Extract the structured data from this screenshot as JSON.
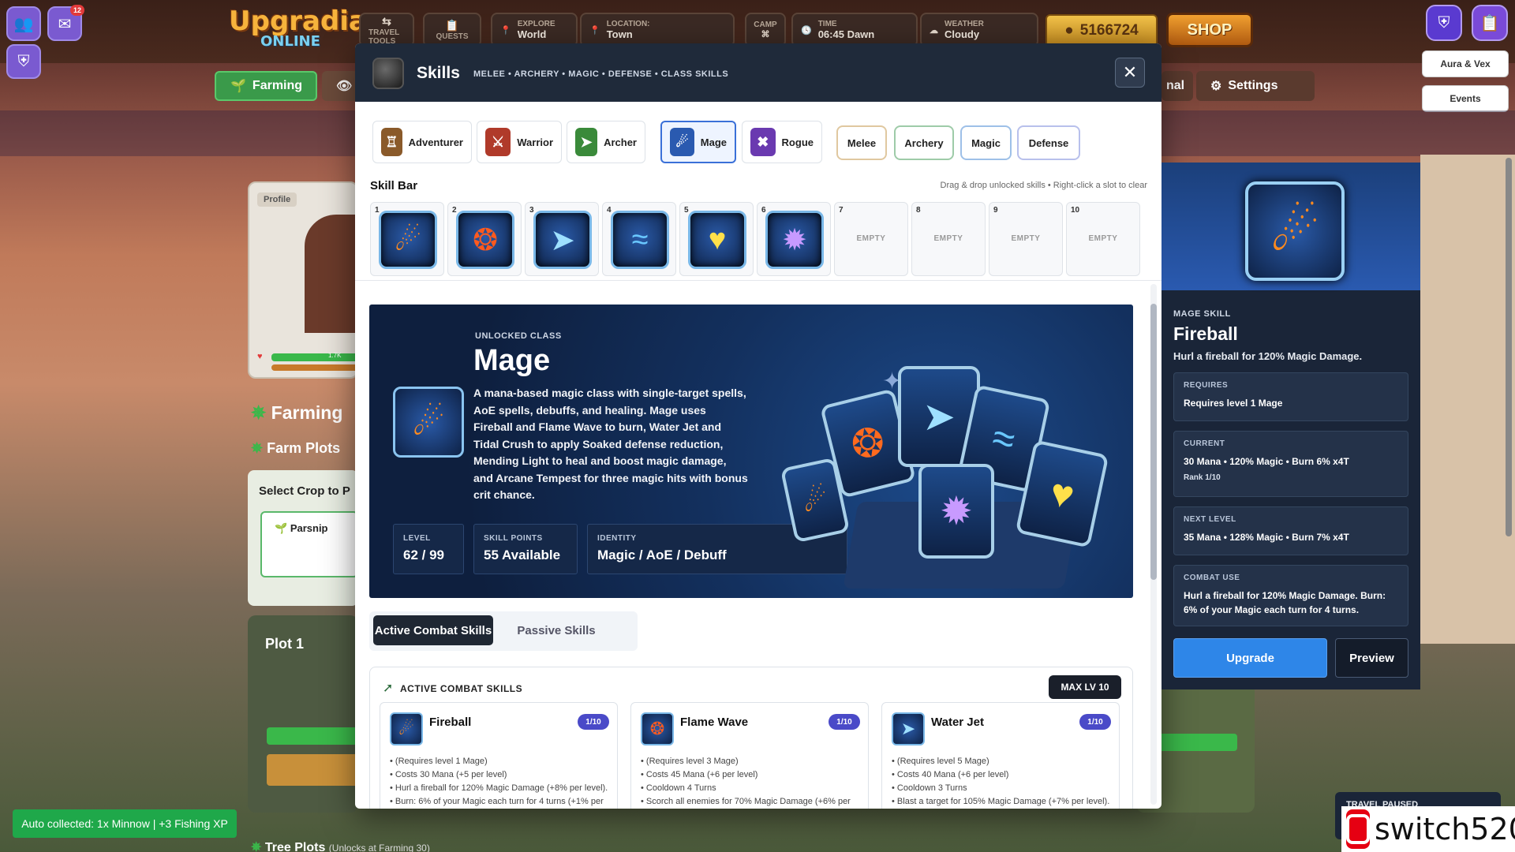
{
  "hud": {
    "logo_top": "Upgradia",
    "logo_bottom": "ONLINE",
    "travel_label": "TRAVEL TOOLS",
    "quests_label": "QUESTS",
    "explore_label": "EXPLORE",
    "explore_value": "World",
    "location_label": "LOCATION:",
    "location_value": "Town",
    "camp_label": "CAMP",
    "time_label": "TIME",
    "time_value": "06:45 Dawn",
    "weather_label": "WEATHER",
    "weather_value": "Cloudy",
    "coins": "5166724",
    "shop": "SHOP",
    "mail_badge": "12"
  },
  "nav": {
    "farming": "Farming",
    "settings": "Settings",
    "hidden_tab_fragment": "nal"
  },
  "side_buttons": {
    "aura": "Aura & Vex",
    "events": "Events"
  },
  "background": {
    "profile_label": "Profile",
    "farming_title": "Farming",
    "farm_plots": "Farm Plots",
    "select_crop": "Select Crop to P",
    "parsnip": "Parsnip",
    "plot1": "Plot 1",
    "tree_plots": "Tree Plots",
    "tree_unlock": "(Unlocks at Farming 30)",
    "hp_value": "1.7K"
  },
  "modal": {
    "title": "Skills",
    "subtitle": "MELEE • ARCHERY • MAGIC • DEFENSE • CLASS SKILLS",
    "class_tabs": [
      {
        "label": "Adventurer",
        "icon": "adventurer-icon",
        "color": "#8a5a2a"
      },
      {
        "label": "Warrior",
        "icon": "warrior-icon",
        "color": "#b03a2a"
      },
      {
        "label": "Archer",
        "icon": "archer-icon",
        "color": "#3a8a3a"
      },
      {
        "label": "Mage",
        "icon": "mage-icon",
        "color": "#2a5ab0"
      },
      {
        "label": "Rogue",
        "icon": "rogue-icon",
        "color": "#6a3ab0"
      }
    ],
    "active_class": "Mage",
    "filters": [
      "Melee",
      "Archery",
      "Magic",
      "Defense"
    ],
    "skill_bar_label": "Skill Bar",
    "skill_bar_hint": "Drag & drop unlocked skills • Right-click a slot to clear",
    "slots": [
      {
        "num": "1",
        "skill": "fireball-icon"
      },
      {
        "num": "2",
        "skill": "flame-wave-icon"
      },
      {
        "num": "3",
        "skill": "water-jet-icon"
      },
      {
        "num": "4",
        "skill": "tidal-crush-icon"
      },
      {
        "num": "5",
        "skill": "mending-light-icon"
      },
      {
        "num": "6",
        "skill": "arcane-tempest-icon"
      },
      {
        "num": "7",
        "empty": "EMPTY"
      },
      {
        "num": "8",
        "empty": "EMPTY"
      },
      {
        "num": "9",
        "empty": "EMPTY"
      },
      {
        "num": "10",
        "empty": "EMPTY"
      }
    ],
    "banner": {
      "tag": "UNLOCKED CLASS",
      "name": "Mage",
      "description": "A mana-based magic class with single-target spells, AoE spells, debuffs, and healing. Mage uses Fireball and Flame Wave to burn, Water Jet and Tidal Crush to apply Soaked defense reduction, Mending Light to heal and boost magic damage, and Arcane Tempest for three magic hits with bonus crit chance.",
      "level_label": "LEVEL",
      "level_value": "62 / 99",
      "sp_label": "SKILL POINTS",
      "sp_value": "55 Available",
      "identity_label": "IDENTITY",
      "identity_value": "Magic / AoE / Debuff"
    },
    "subtabs": {
      "active": "Active Combat Skills",
      "passive": "Passive Skills"
    },
    "active_section": {
      "heading": "ACTIVE COMBAT SKILLS",
      "max_level": "MAX LV 10",
      "cards": [
        {
          "name": "Fireball",
          "rank": "1/10",
          "lines": [
            "(Requires level 1 Mage)",
            "Costs 30 Mana (+5 per level)",
            "Hurl a fireball for 120% Magic Damage (+8% per level).",
            "Burn: 6% of your Magic each turn for 4 turns (+1% per"
          ]
        },
        {
          "name": "Flame Wave",
          "rank": "1/10",
          "lines": [
            "(Requires level 3 Mage)",
            "Costs 45 Mana (+6 per level)",
            "Cooldown 4 Turns",
            "Scorch all enemies for 70% Magic Damage (+6% per"
          ]
        },
        {
          "name": "Water Jet",
          "rank": "1/10",
          "lines": [
            "(Requires level 5 Mage)",
            "Costs 40 Mana (+6 per level)",
            "Cooldown 3 Turns",
            "Blast a target for 105% Magic Damage (+7% per level)."
          ]
        }
      ]
    }
  },
  "detail": {
    "tag": "MAGE SKILL",
    "name": "Fireball",
    "desc": "Hurl a fireball for 120% Magic Damage.",
    "requires_label": "REQUIRES",
    "requires_value": "Requires level 1 Mage",
    "current_label": "CURRENT",
    "current_value": "30 Mana • 120% Magic • Burn 6% x4T",
    "current_rank": "Rank 1/10",
    "next_label": "NEXT LEVEL",
    "next_value": "35 Mana • 128% Magic • Burn 7% x4T",
    "combat_label": "COMBAT USE",
    "combat_value": "Hurl a fireball for 120% Magic Damage. Burn: 6% of your Magic each turn for 4 turns.",
    "upgrade": "Upgrade",
    "preview": "Preview"
  },
  "toast": "Auto collected: 1x Minnow | +3 Fishing XP",
  "travel_paused": "TRAVEL PAUSED",
  "watermark": "switch520"
}
